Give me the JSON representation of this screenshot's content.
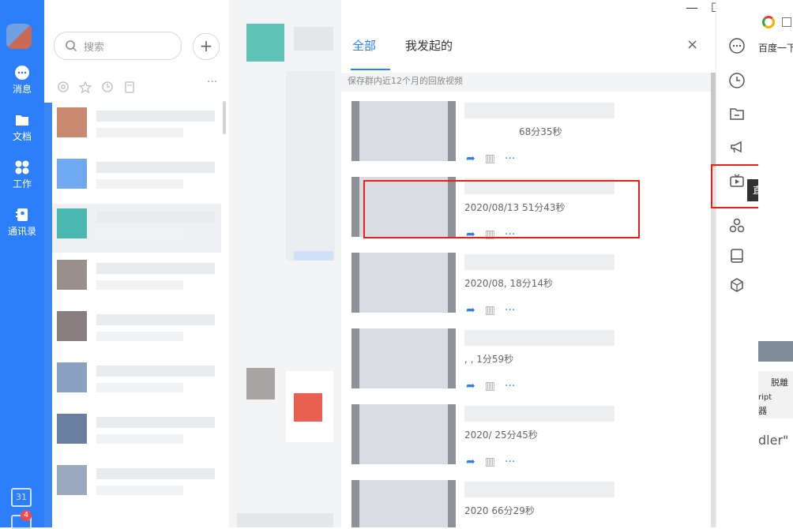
{
  "nav": {
    "items": [
      {
        "label": "消息",
        "icon": "chat-bubble-icon"
      },
      {
        "label": "文档",
        "icon": "folder-icon"
      },
      {
        "label": "工作",
        "icon": "grid-icon"
      },
      {
        "label": "通讯录",
        "icon": "contacts-icon"
      }
    ],
    "calendar_label": "31",
    "badge_count": "4"
  },
  "chatlist": {
    "search_placeholder": "搜索",
    "add_label": "+",
    "filter_icons": [
      "mention-icon",
      "star-icon",
      "clock-icon",
      "file-icon"
    ],
    "more_label": "···"
  },
  "window": {
    "minimize": "—",
    "maximize": "☐",
    "close": "✕"
  },
  "panel": {
    "tabs": [
      "全部",
      "我发起的"
    ],
    "active_tab": "全部",
    "close_label": "×",
    "notice": "保存群内近12个月的回放视频",
    "items": [
      {
        "meta": "68分35秒"
      },
      {
        "meta": "2020/08/13 51分43秒"
      },
      {
        "meta": "2020/08,     18分14秒"
      },
      {
        "meta": ", ,  1分59秒"
      },
      {
        "meta": "2020/        25分45秒"
      },
      {
        "meta": "2020         66分29秒"
      }
    ],
    "action_icons": [
      "share-icon",
      "stats-icon",
      "more-icon"
    ]
  },
  "sidebar": {
    "icons": [
      "more-circle-icon",
      "clock-icon",
      "folder-icon",
      "megaphone-icon",
      "live-replay-icon",
      "apps-icon",
      "book-icon",
      "cube-plus-icon"
    ],
    "tooltip": "直播回放"
  },
  "browser": {
    "text1": "百度一下",
    "text2": "脱離",
    "text3": "ript",
    "text4": "器",
    "text5": "dler\""
  },
  "colors": {
    "accent": "#2d7ff9",
    "highlight": "#e8201a",
    "nav_bg": "#2d7ff9"
  }
}
